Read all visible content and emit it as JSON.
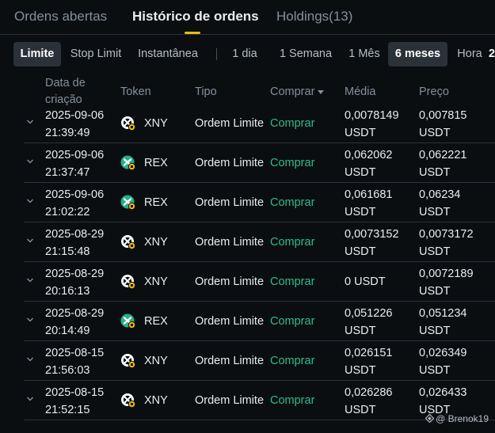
{
  "tabs": [
    {
      "label": "Ordens abertas",
      "active": false
    },
    {
      "label": "Histórico de ordens",
      "active": true
    },
    {
      "label": "Holdings(13)",
      "active": false
    }
  ],
  "filters": {
    "order_types": [
      "Limite",
      "Stop Limit",
      "Instantânea"
    ],
    "periods": [
      "1 dia",
      "1 Semana",
      "1 Mês",
      "6 meses",
      "Hora",
      "2"
    ],
    "active_order_type": "Limite",
    "active_period": "6 meses"
  },
  "columns": {
    "date_line1": "Data de",
    "date_line2": "criação",
    "token": "Token",
    "type": "Tipo",
    "side": "Comprar",
    "avg": "Média",
    "price": "Preço"
  },
  "rows": [
    {
      "date": "2025-09-06",
      "time": "21:39:49",
      "token": "XNY",
      "icon": "xny-token-icon",
      "type": "Ordem Limite",
      "side": "Comprar",
      "avg": "0,0078149",
      "avg_unit": "USDT",
      "price": "0,007815",
      "price_unit": "USDT"
    },
    {
      "date": "2025-09-06",
      "time": "21:37:47",
      "token": "REX",
      "icon": "rex-token-icon",
      "type": "Ordem Limite",
      "side": "Comprar",
      "avg": "0,062062",
      "avg_unit": "USDT",
      "price": "0,062221",
      "price_unit": "USDT"
    },
    {
      "date": "2025-09-06",
      "time": "21:02:22",
      "token": "REX",
      "icon": "rex-token-icon",
      "type": "Ordem Limite",
      "side": "Comprar",
      "avg": "0,061681",
      "avg_unit": "USDT",
      "price": "0,06234",
      "price_unit": "USDT"
    },
    {
      "date": "2025-08-29",
      "time": "21:15:48",
      "token": "XNY",
      "icon": "xny-token-icon",
      "type": "Ordem Limite",
      "side": "Comprar",
      "avg": "0,0073152",
      "avg_unit": "USDT",
      "price": "0,0073172",
      "price_unit": "USDT"
    },
    {
      "date": "2025-08-29",
      "time": "20:16:13",
      "token": "XNY",
      "icon": "xny-token-icon",
      "type": "Ordem Limite",
      "side": "Comprar",
      "avg": "0 USDT",
      "avg_unit": "",
      "price": "0,0072189",
      "price_unit": "USDT"
    },
    {
      "date": "2025-08-29",
      "time": "20:14:49",
      "token": "REX",
      "icon": "rex-token-icon",
      "type": "Ordem Limite",
      "side": "Comprar",
      "avg": "0,051226",
      "avg_unit": "USDT",
      "price": "0,051234",
      "price_unit": "USDT"
    },
    {
      "date": "2025-08-15",
      "time": "21:56:03",
      "token": "XNY",
      "icon": "xny-token-icon",
      "type": "Ordem Limite",
      "side": "Comprar",
      "avg": "0,026151",
      "avg_unit": "USDT",
      "price": "0,026349",
      "price_unit": "USDT"
    },
    {
      "date": "2025-08-15",
      "time": "21:52:15",
      "token": "XNY",
      "icon": "xny-token-icon",
      "type": "Ordem Limite",
      "side": "Comprar",
      "avg": "0,026286",
      "avg_unit": "USDT",
      "price": "0,026433",
      "price_unit": "USDT"
    }
  ],
  "watermark": "@ Brenok19",
  "colors": {
    "background": "#0b0e11",
    "accent": "#f0b90b",
    "buy": "#2ebd85",
    "muted": "#848e9c",
    "divider": "#2b3139"
  }
}
